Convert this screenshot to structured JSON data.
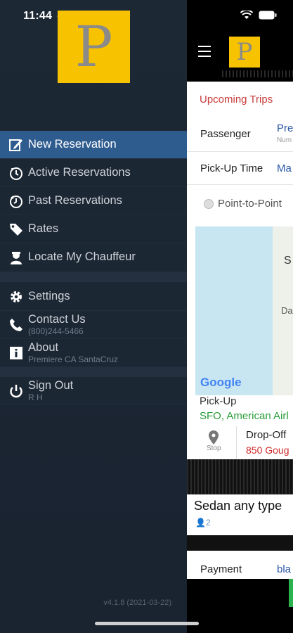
{
  "status_bar": {
    "time": "11:44",
    "location_arrow": "↗"
  },
  "drawer": {
    "logo_letter": "P",
    "menu_items": [
      {
        "label": "New Reservation",
        "icon": "edit-icon",
        "active": true
      },
      {
        "label": "Active Reservations",
        "icon": "refresh-clock-icon",
        "active": false
      },
      {
        "label": "Past Reservations",
        "icon": "history-icon",
        "active": false
      },
      {
        "label": "Rates",
        "icon": "tag-icon",
        "active": false
      },
      {
        "label": "Locate My Chauffeur",
        "icon": "chauffeur-icon",
        "active": false
      }
    ],
    "tool_items": [
      {
        "label": "Settings",
        "sub": "",
        "icon": "gear-icon"
      },
      {
        "label": "Contact Us",
        "sub": "(800)244-5466",
        "icon": "phone-icon"
      },
      {
        "label": "About",
        "sub": "Premiere CA SantaCruz",
        "icon": "info-icon"
      }
    ],
    "sign_out": {
      "label": "Sign Out",
      "sub": "R H",
      "icon": "power-icon"
    },
    "version": "v4.1.8 (2021-03-22)"
  },
  "main": {
    "logo_letter": "P",
    "upcoming_trips": "Upcoming Trips",
    "passenger_label": "Passenger",
    "passenger_value": "Pre",
    "passenger_sub": "Num",
    "pickup_time_label": "Pick-Up Time",
    "pickup_time_value": "Ma",
    "trip_type": "Point-to-Point",
    "map_brand": "Google",
    "map_letters": [
      "S",
      "Da"
    ],
    "pickup_label": "Pick-Up",
    "pickup_value": "SFO, American Airl",
    "stop_label": "Stop",
    "dropoff_label": "Drop-Off",
    "dropoff_value": "850 Goug",
    "vehicle_title": "Sedan any type",
    "vehicle_passengers": "2",
    "payment_label": "Payment",
    "payment_value": "bla"
  }
}
